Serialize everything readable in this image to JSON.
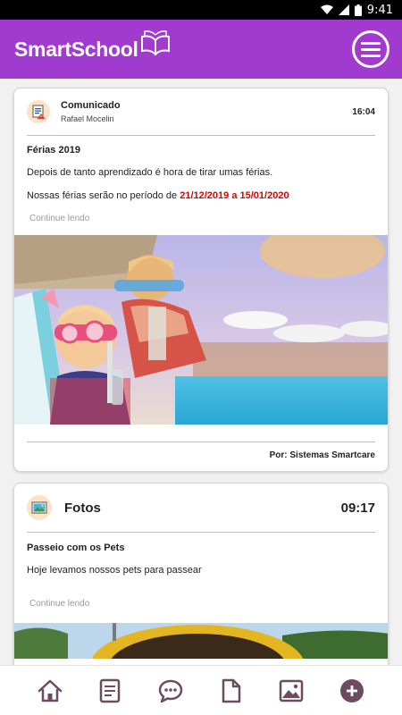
{
  "status_bar": {
    "time": "9:41"
  },
  "app_bar": {
    "logo_text": "SmartSchool"
  },
  "posts": [
    {
      "category": "Comunicado",
      "author": "Rafael Mocelin",
      "time": "16:04",
      "title": "Férias 2019",
      "text1": "Depois de tanto aprendizado é hora de tirar umas férias.",
      "text2_prefix": "Nossas férias serão no período de ",
      "text2_highlight": "21/12/2019 a 15/01/2020",
      "continue_label": "Continue lendo",
      "by_label": "Por: Sistemas Smartcare"
    },
    {
      "category": "Fotos",
      "time": "09:17",
      "title": "Passeio com os Pets",
      "text1": "Hoje levamos nossos pets para passear",
      "continue_label": "Continue lendo"
    }
  ],
  "bottom_nav": [
    "home-icon",
    "notice-icon",
    "chat-icon",
    "document-icon",
    "image-icon",
    "add-icon"
  ],
  "colors": {
    "brand": "#a13bd0",
    "nav_icon": "#6d4c5f",
    "highlight": "#e00000"
  }
}
